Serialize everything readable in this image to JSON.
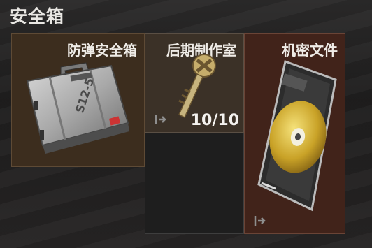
{
  "panel": {
    "title": "安全箱"
  },
  "slots": [
    {
      "name": "防弹安全箱",
      "case_label": "S12-5"
    },
    {
      "name": "后期制作室",
      "count": "10/10"
    },
    {
      "name": "机密文件"
    }
  ],
  "colors": {
    "slot1_bg": "#3c2d1e",
    "slot2_bg": "#3b3127",
    "slot3_bg": "#41231a",
    "empty_bg": "#1e1e1e"
  },
  "icons": [
    "exit-arrow-icon",
    "briefcase-icon",
    "key-icon",
    "disc-icon"
  ]
}
